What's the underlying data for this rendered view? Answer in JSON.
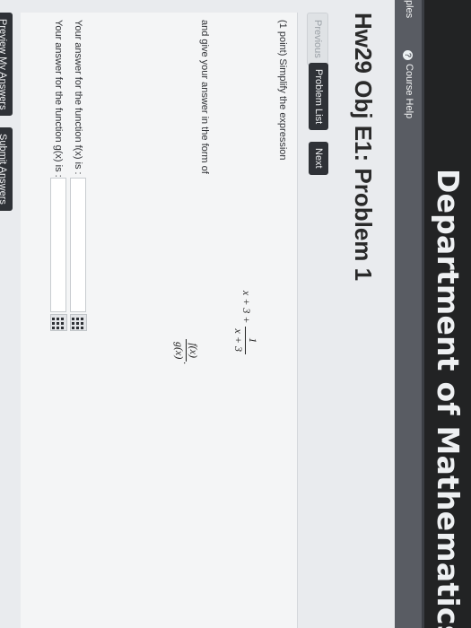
{
  "header": {
    "title": "Department of Mathematics"
  },
  "subnav": {
    "left_text": "ples",
    "course_help": "Course Help",
    "course_help_icon": "help-circle-icon"
  },
  "problem": {
    "title": "Hw29 Obj E1: Problem 1",
    "buttons": {
      "previous": "Previous",
      "problem_list": "Problem List",
      "next": "Next"
    },
    "intro": "(1 point) Simplify the expression",
    "expression": {
      "lead": "x + 3 +",
      "frac_num": "1",
      "frac_den": "x + 3"
    },
    "form_text": "and give your answer in the form of",
    "form": {
      "num": "f(x)",
      "den": "g(x)",
      "trail": "."
    },
    "answer_f_label": "Your answer for the function f(x) is :",
    "answer_g_label": "Your answer for the function g(x) is :",
    "answer_f_value": "",
    "answer_g_value": "",
    "equation_editor_icon": "grid-icon"
  },
  "actions": {
    "preview": "Preview My Answers",
    "submit": "Submit Answers"
  }
}
